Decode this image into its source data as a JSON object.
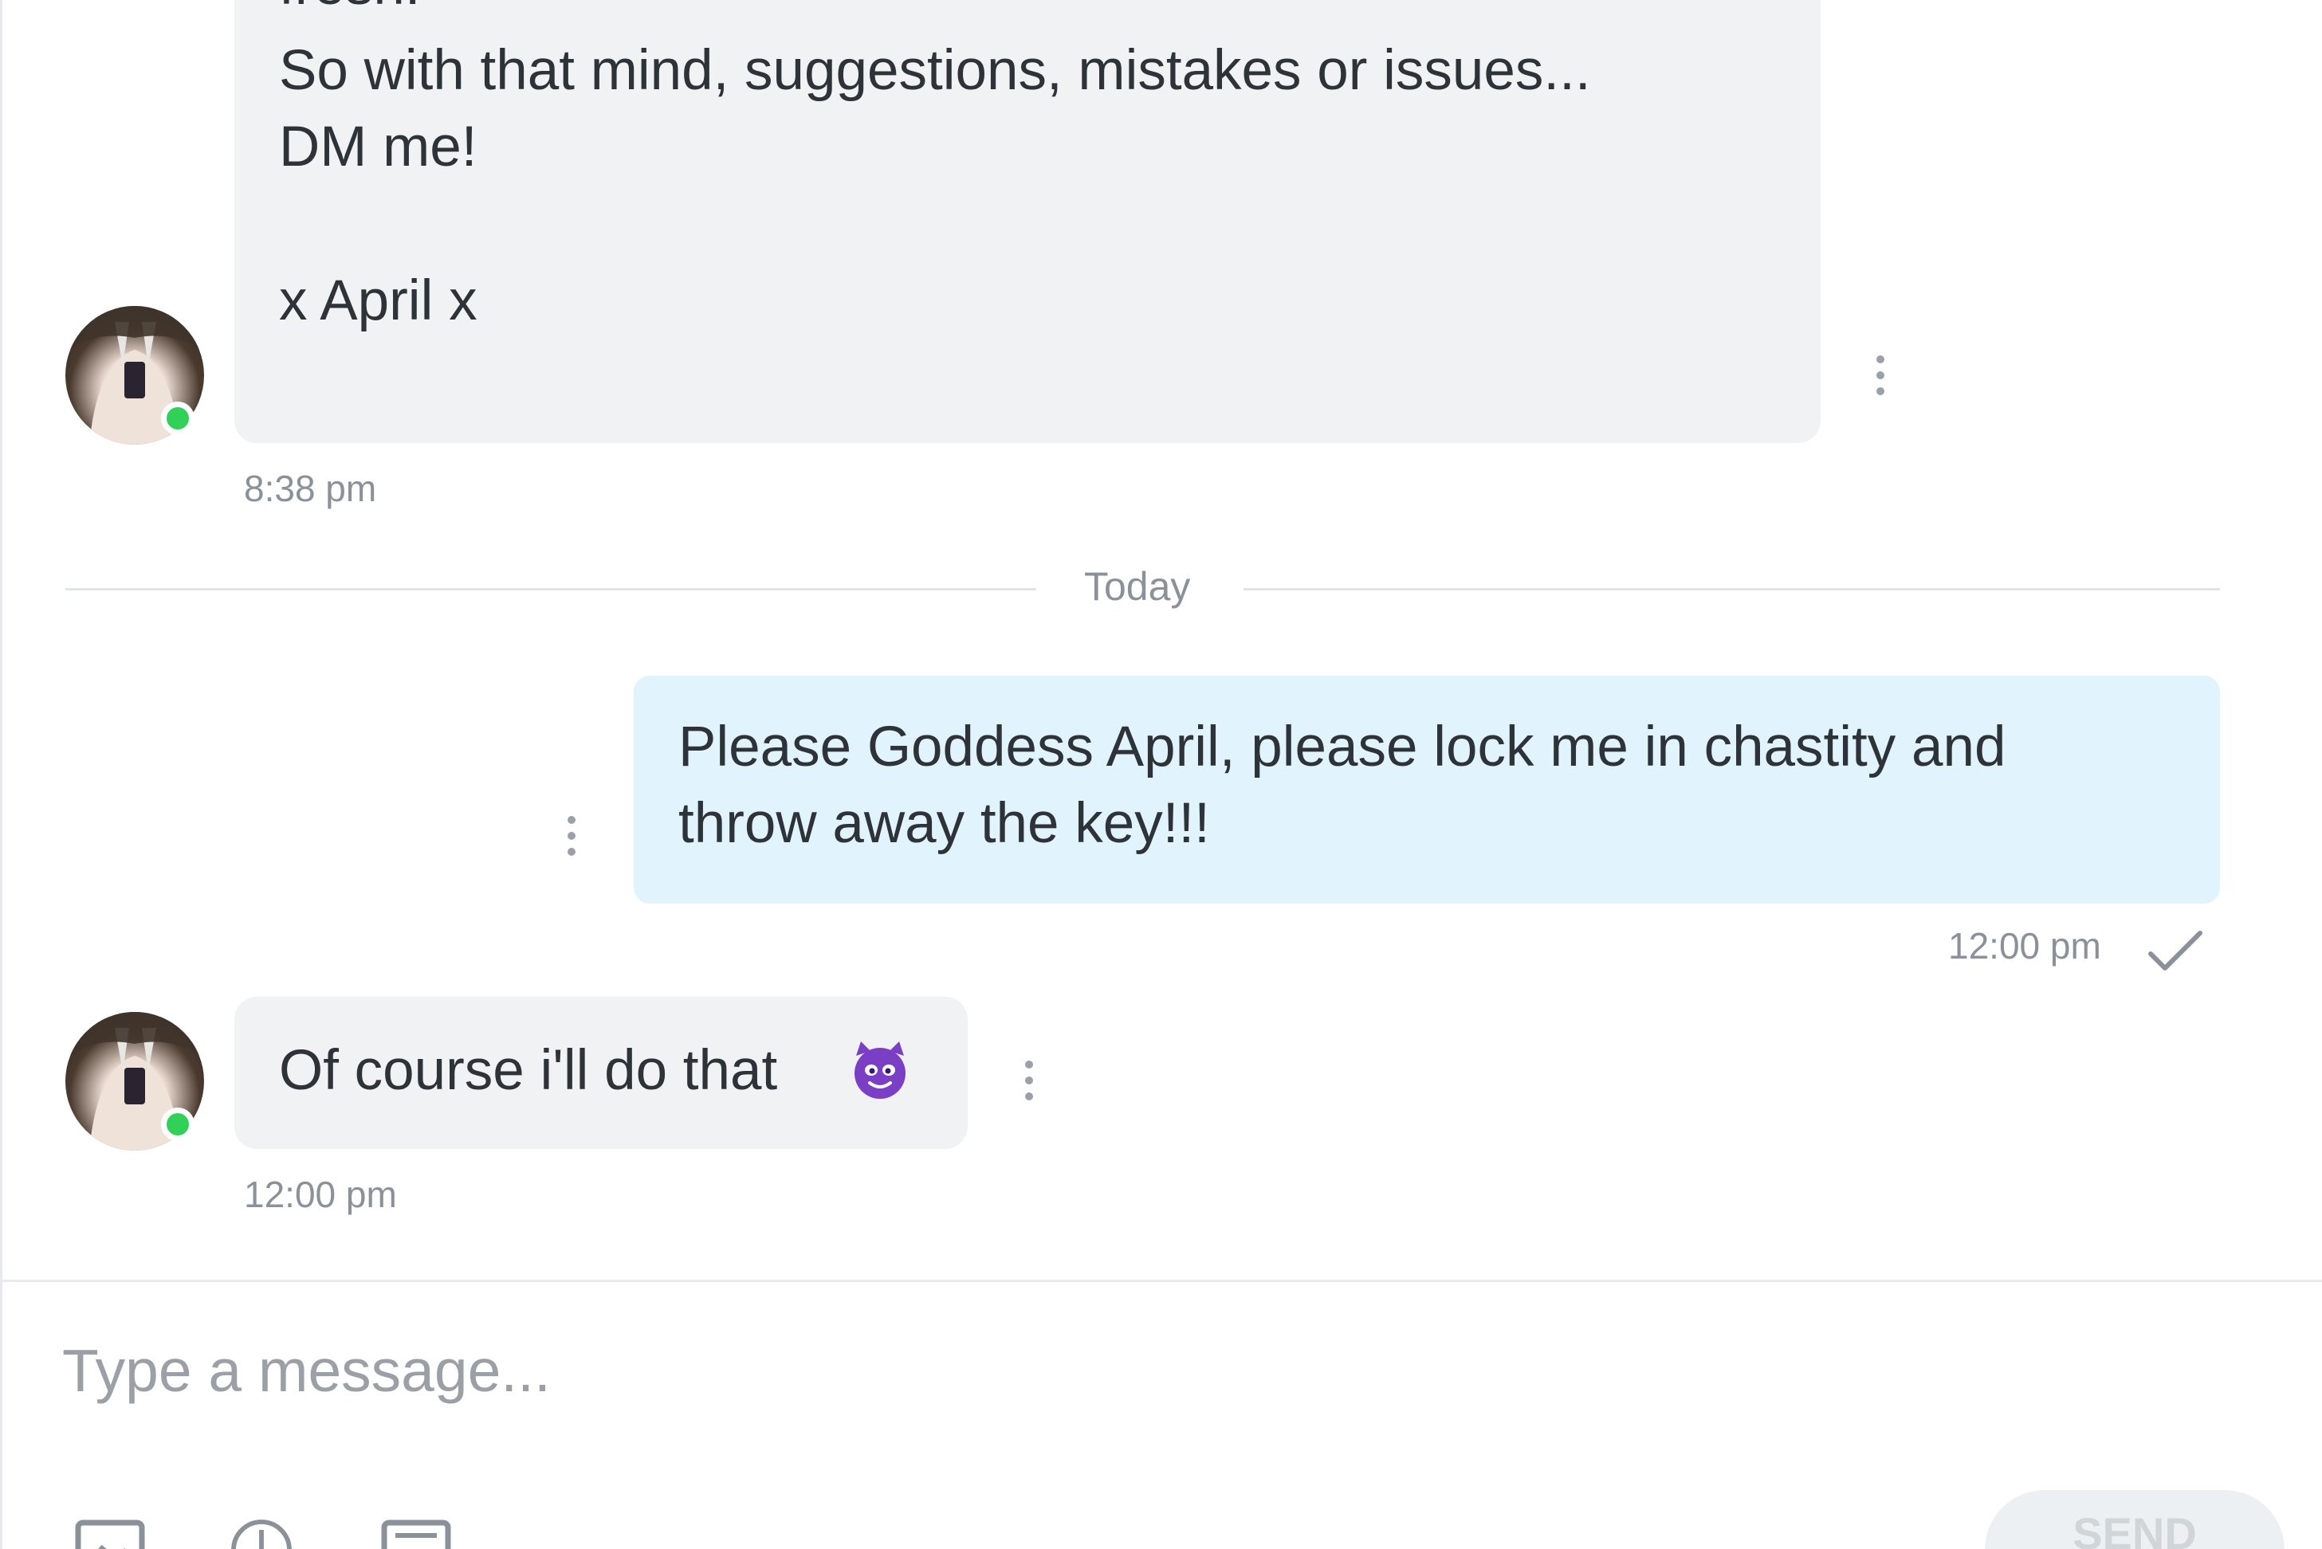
{
  "conversation": {
    "messages": [
      {
        "direction": "incoming",
        "lines": [
          "fresh!",
          "",
          "So with that mind, suggestions, mistakes or issues...",
          "DM me!",
          "",
          "x April x"
        ],
        "time": "8:38 pm"
      },
      {
        "direction": "outgoing",
        "lines": [
          "Please Goddess April, please lock me in chastity and",
          "throw away the key!!!"
        ],
        "time": "12:00 pm",
        "status_icon": "check-icon"
      },
      {
        "direction": "incoming",
        "text": "Of course i'll do that",
        "emoji": "smiling-imp-emoji",
        "time": "12:00 pm"
      }
    ],
    "day_separator": "Today"
  },
  "composer": {
    "placeholder": "Type a message...",
    "send_label": "SEND",
    "tools": [
      "image-icon",
      "tip-icon",
      "gif-icon"
    ]
  },
  "colors": {
    "incoming_bubble": "#f1f2f4",
    "outgoing_bubble": "#e1f4fd",
    "online": "#31d158",
    "emoji": "#7b3fc6"
  }
}
